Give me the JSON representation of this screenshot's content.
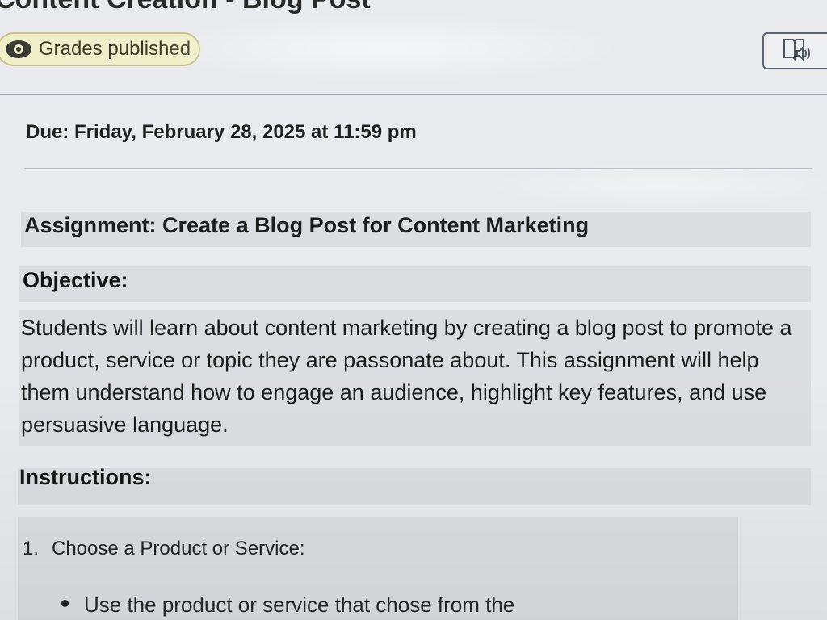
{
  "header": {
    "title": "Content Creation - Blog Post",
    "status_badge": "Grades published",
    "status_icon": "eye-icon",
    "reader_icon": "immersive-reader-icon"
  },
  "assignment": {
    "due": "Due: Friday, February 28, 2025 at 11:59 pm",
    "heading": "Assignment: Create a Blog Post for Content Marketing",
    "objective_label": "Objective:",
    "objective_text": "Students will learn about content marketing by creating a blog post to promote a product, service or topic they are passonate about. This assignment will help them understand how to engage an audience, highlight key features, and use persuasive language.",
    "instructions_label": "Instructions:",
    "instructions": [
      {
        "number": "1.",
        "text": "Choose a Product or Service:",
        "bullets": [
          "Use the product or service that chose from the"
        ]
      }
    ]
  }
}
